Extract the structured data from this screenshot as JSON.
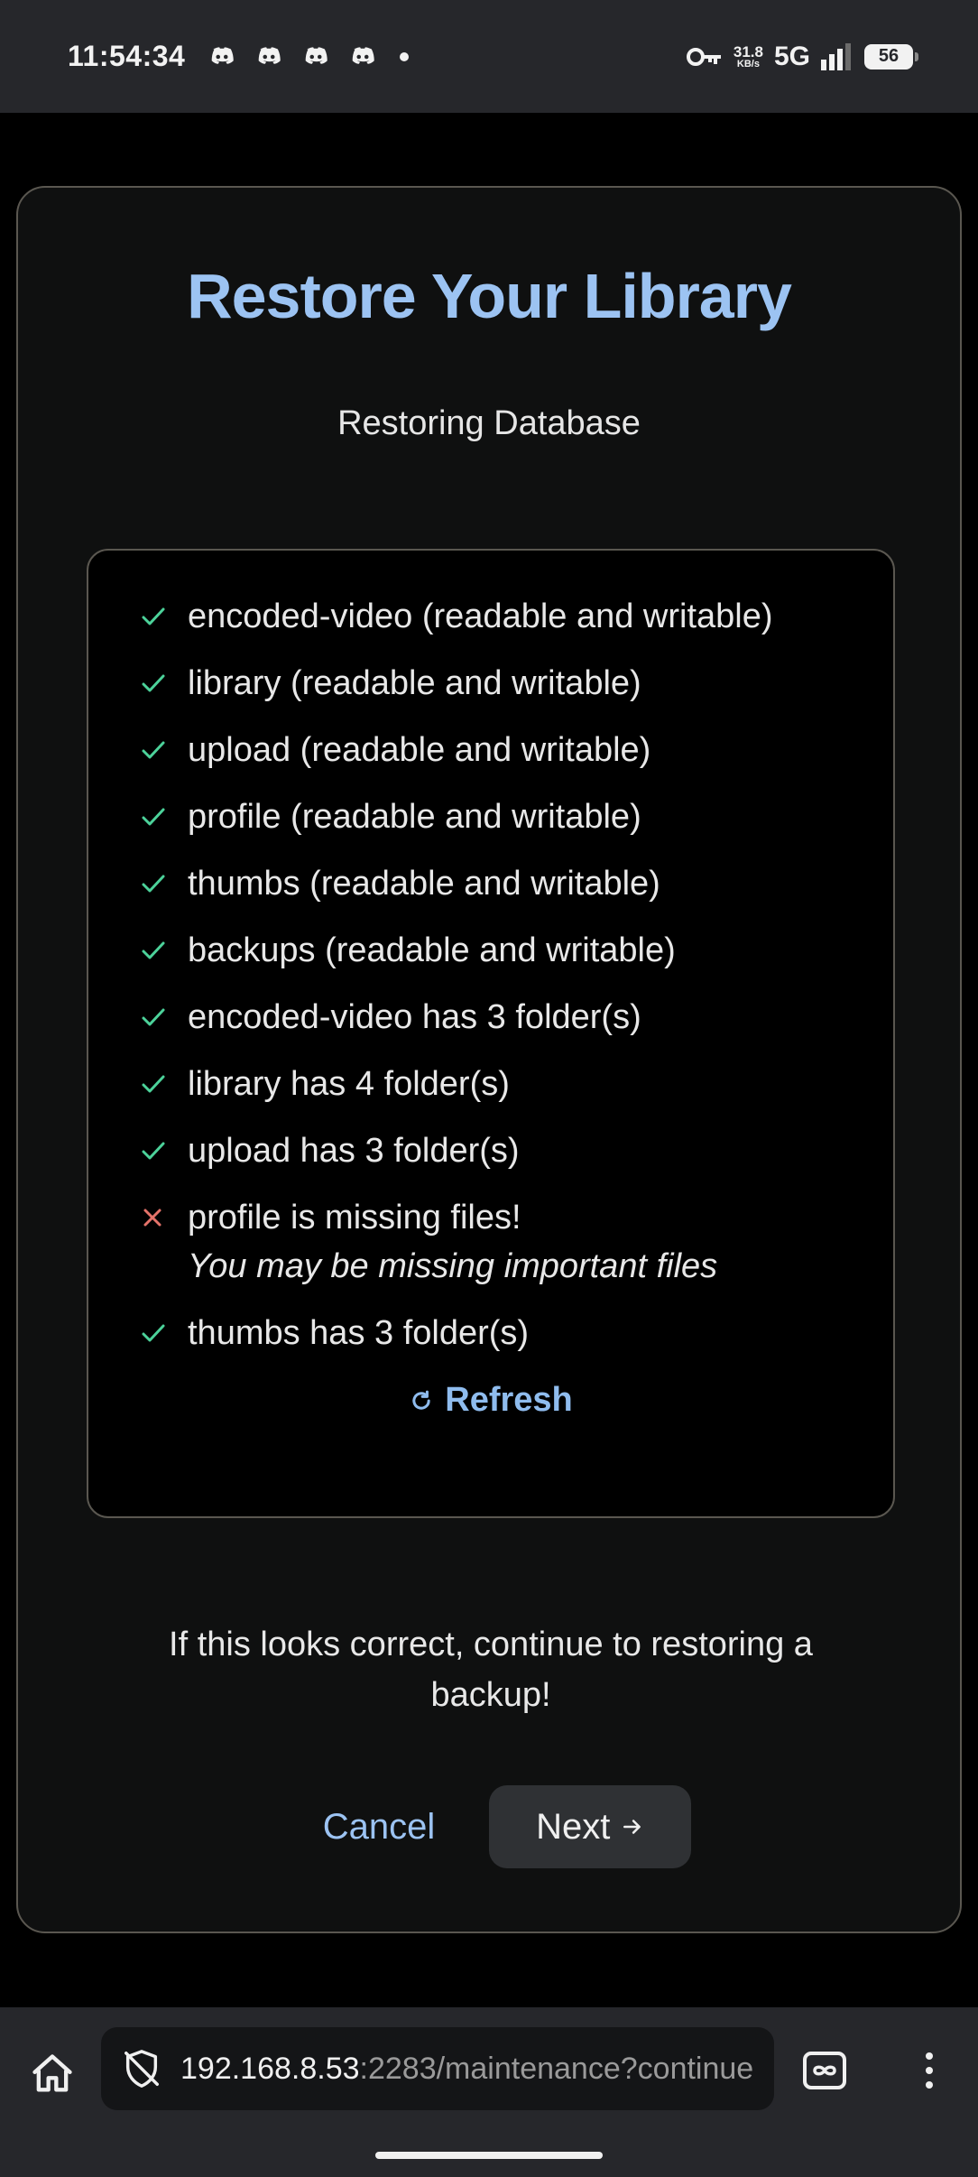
{
  "status_bar": {
    "time": "11:54:34",
    "net_speed_value": "31.8",
    "net_speed_unit": "KB/s",
    "network": "5G",
    "battery": "56",
    "notification_icons": [
      "discord-icon",
      "discord-icon",
      "discord-icon",
      "discord-icon"
    ]
  },
  "card": {
    "title": "Restore Your Library",
    "subtitle": "Restoring Database",
    "checks": [
      {
        "status": "ok",
        "text": "encoded-video (readable and writable)"
      },
      {
        "status": "ok",
        "text": "library (readable and writable)"
      },
      {
        "status": "ok",
        "text": "upload (readable and writable)"
      },
      {
        "status": "ok",
        "text": "profile (readable and writable)"
      },
      {
        "status": "ok",
        "text": "thumbs (readable and writable)"
      },
      {
        "status": "ok",
        "text": "backups (readable and writable)"
      },
      {
        "status": "ok",
        "text": "encoded-video has 3 folder(s)"
      },
      {
        "status": "ok",
        "text": "library has 4 folder(s)"
      },
      {
        "status": "ok",
        "text": "upload has 3 folder(s)"
      },
      {
        "status": "error",
        "text": "profile is missing files!",
        "note": "You may be missing important files"
      },
      {
        "status": "ok",
        "text": "thumbs has 3 folder(s)"
      }
    ],
    "refresh_label": "Refresh",
    "prompt": "If this looks correct, continue to restoring a backup!",
    "cancel_label": "Cancel",
    "next_label": "Next"
  },
  "browser": {
    "url_host": "192.168.8.53",
    "url_path": ":2283/maintenance?continue"
  },
  "colors": {
    "accent": "#9cc3f2",
    "success": "#4cd29a",
    "error": "#e5736a",
    "card_bg": "#0f1010",
    "chrome_bg": "#26272b"
  }
}
